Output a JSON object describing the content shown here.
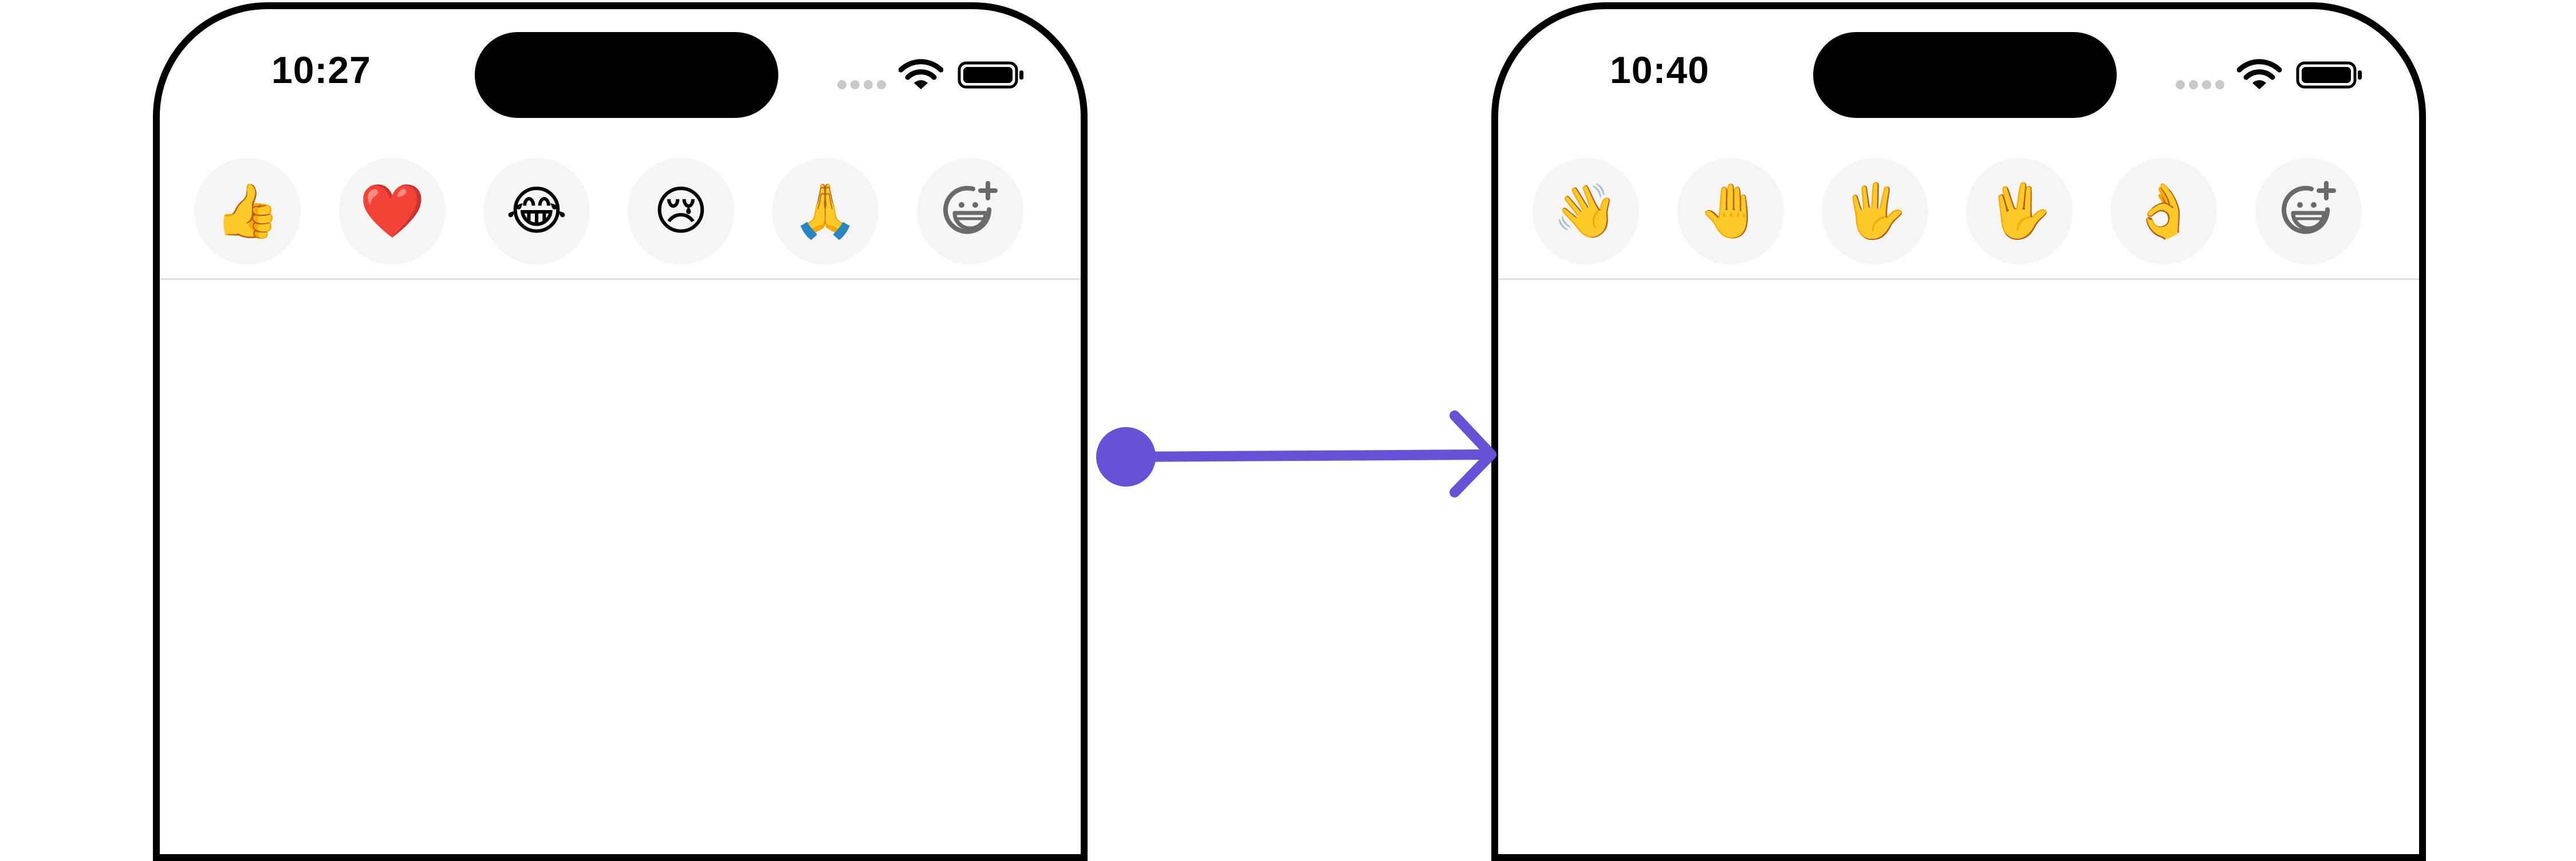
{
  "screens": {
    "before": {
      "status": {
        "time": "10:27"
      },
      "reactions": [
        {
          "icon": "thumbs-up-icon",
          "glyph": "👍"
        },
        {
          "icon": "red-heart-icon",
          "glyph": "❤️"
        },
        {
          "icon": "tears-of-joy-icon",
          "glyph": "😂"
        },
        {
          "icon": "crying-face-icon",
          "glyph": "😢"
        },
        {
          "icon": "folded-hands-icon",
          "glyph": "🙏"
        },
        {
          "icon": "add-reaction-icon",
          "glyph": ""
        }
      ]
    },
    "after": {
      "status": {
        "time": "10:40"
      },
      "reactions": [
        {
          "icon": "waving-hand-icon",
          "glyph": "👋"
        },
        {
          "icon": "raised-back-of-hand-icon",
          "glyph": "🤚"
        },
        {
          "icon": "hand-fingers-splayed-icon",
          "glyph": "🖐️"
        },
        {
          "icon": "vulcan-salute-icon",
          "glyph": "🖖"
        },
        {
          "icon": "ok-hand-icon",
          "glyph": "👌"
        },
        {
          "icon": "add-reaction-icon",
          "glyph": ""
        }
      ]
    }
  },
  "colors": {
    "frame": "#000000",
    "reaction_bg": "#f5f5f5",
    "divider": "#e2e2e2",
    "arrow": "#6652d6",
    "signal_dots": "#c8c8c8"
  }
}
